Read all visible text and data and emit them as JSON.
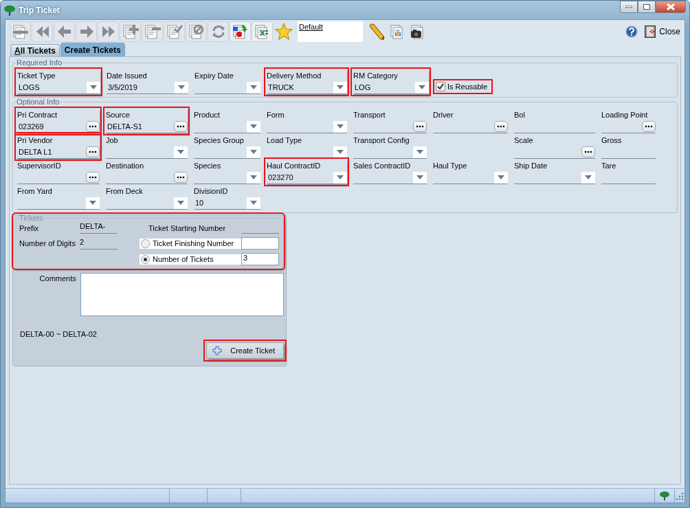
{
  "window": {
    "title": "Trip Ticket"
  },
  "toolbar": [
    {
      "kind": "delete",
      "disabled": true
    },
    {
      "kind": "first",
      "disabled": true
    },
    {
      "kind": "prev",
      "disabled": true
    },
    {
      "kind": "next",
      "disabled": true
    },
    {
      "kind": "last",
      "disabled": true
    },
    {
      "kind": "add",
      "disabled": true
    },
    {
      "kind": "remove",
      "disabled": true
    },
    {
      "kind": "approve",
      "disabled": true
    },
    {
      "kind": "cancel",
      "disabled": true
    },
    {
      "kind": "refresh",
      "disabled": true
    },
    {
      "kind": "import",
      "disabled": false
    },
    {
      "kind": "excel",
      "disabled": false
    }
  ],
  "preset": {
    "value": "Default"
  },
  "right_toolbar": {
    "close_label": "Close"
  },
  "tabs": [
    {
      "label": "All Tickets",
      "selected": false
    },
    {
      "label": "Create Tickets",
      "selected": true
    }
  ],
  "required": {
    "title": "Required Info",
    "fields": [
      {
        "label": "Ticket Type",
        "kind": "dropdown",
        "value": "LOGS",
        "highlighted": true
      },
      {
        "label": "Date Issued",
        "kind": "dropdown",
        "value": "3/5/2019",
        "highlighted": false
      },
      {
        "label": "Expiry Date",
        "kind": "dropdown",
        "highlighted": false
      },
      {
        "label": "Delivery Method",
        "kind": "dropdown",
        "value": "TRUCK",
        "highlighted": true
      },
      {
        "label": "RM Category",
        "kind": "dropdown",
        "value": "LOG",
        "highlighted": true
      }
    ],
    "reusable": {
      "label": "Is Reusable",
      "checked": true,
      "highlighted": true
    }
  },
  "optional": {
    "title": "Optional Info",
    "fields": [
      {
        "label": "Pri Contract",
        "kind": "lookup",
        "value": "023269",
        "highlighted": true
      },
      {
        "label": "Source",
        "kind": "lookup",
        "value": "DELTA-S1",
        "highlighted": true
      },
      {
        "label": "Product",
        "kind": "dropdown",
        "highlighted": false
      },
      {
        "label": "Form",
        "kind": "dropdown",
        "highlighted": false
      },
      {
        "label": "Transport",
        "kind": "lookup",
        "highlighted": false
      },
      {
        "label": "Driver",
        "kind": "lookup",
        "highlighted": false
      },
      {
        "label": "Bol",
        "kind": "text",
        "highlighted": false
      },
      {
        "label": "Loading Point",
        "kind": "lookup",
        "highlighted": false
      },
      {
        "label": "Pri Vendor",
        "kind": "lookup",
        "value": "DELTA L1",
        "highlighted": true
      },
      {
        "label": "Job",
        "kind": "dropdown",
        "highlighted": false
      },
      {
        "label": "Species Group",
        "kind": "dropdown",
        "highlighted": false
      },
      {
        "label": "Load Type",
        "kind": "dropdown",
        "highlighted": false
      },
      {
        "label": "Transport Config",
        "kind": "dropdown",
        "highlighted": false
      },
      {
        "kind": "empty"
      },
      {
        "label": "Scale",
        "kind": "lookup",
        "highlighted": false
      },
      {
        "label": "Gross",
        "kind": "text",
        "highlighted": false
      },
      {
        "label": "SupervisorID",
        "kind": "lookup",
        "highlighted": false
      },
      {
        "label": "Destination",
        "kind": "lookup",
        "highlighted": false
      },
      {
        "label": "Species",
        "kind": "dropdown",
        "highlighted": false
      },
      {
        "label": "Haul ContractID",
        "kind": "dropdown",
        "value": "023270",
        "highlighted": true
      },
      {
        "label": "Sales ContractID",
        "kind": "dropdown",
        "highlighted": false
      },
      {
        "label": "Haul Type",
        "kind": "dropdown",
        "highlighted": false
      },
      {
        "label": "Ship Date",
        "kind": "dropdown",
        "highlighted": false
      },
      {
        "label": "Tare",
        "kind": "text",
        "highlighted": false
      },
      {
        "label": "From Yard",
        "kind": "dropdown",
        "highlighted": false
      },
      {
        "label": "From Deck",
        "kind": "dropdown",
        "highlighted": false
      },
      {
        "label": "DivisionID",
        "kind": "dropdown",
        "value": "10",
        "highlighted": false
      }
    ]
  },
  "tickets": {
    "title": "Tickets",
    "highlighted": true,
    "prefix_label": "Prefix",
    "prefix": "DELTA-",
    "digits_label": "Number of Digits",
    "digits": "2",
    "start_label": "Ticket Starting Number",
    "modes": [
      {
        "label": "Ticket Finishing Number",
        "selected": false
      },
      {
        "label": "Number of Tickets",
        "selected": true,
        "value": "3"
      }
    ],
    "comments_label": "Comments",
    "range": "DELTA-00 ~ DELTA-02",
    "create": {
      "label": "Create Ticket",
      "highlighted": true
    }
  }
}
